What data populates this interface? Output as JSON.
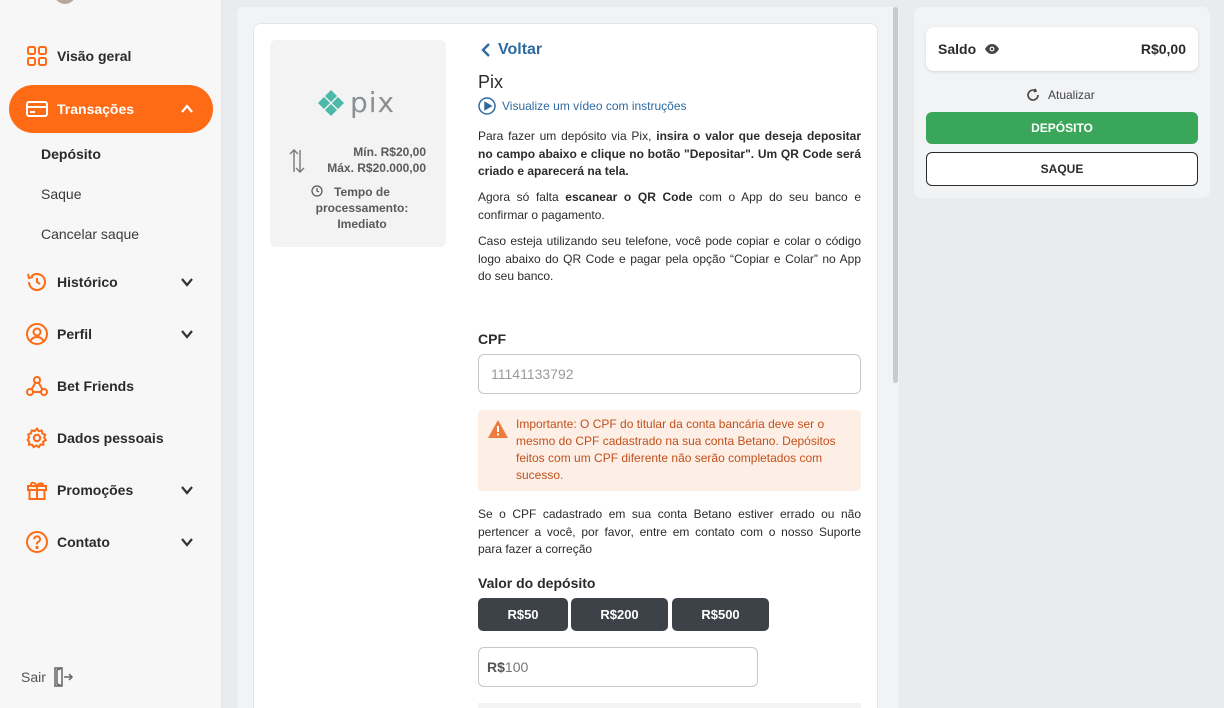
{
  "sidebar": {
    "items": [
      {
        "label": "Visão geral",
        "icon": "grid-icon"
      },
      {
        "label": "Transações",
        "icon": "card-icon"
      },
      {
        "label": "Histórico",
        "icon": "history-icon"
      },
      {
        "label": "Perfil",
        "icon": "user-icon"
      },
      {
        "label": "Bet Friends",
        "icon": "friends-icon"
      },
      {
        "label": "Dados pessoais",
        "icon": "gear-icon"
      },
      {
        "label": "Promoções",
        "icon": "gift-icon"
      },
      {
        "label": "Contato",
        "icon": "help-icon"
      }
    ],
    "subitems": [
      "Depósito",
      "Saque",
      "Cancelar saque"
    ],
    "logout": "Sair"
  },
  "method": {
    "min": "Mín. R$20,00",
    "max": "Máx. R$20.000,00",
    "processing": "Tempo de processamento: Imediato"
  },
  "main": {
    "back": "Voltar",
    "title": "Pix",
    "video_link": "Visualize um vídeo com instruções",
    "p1": {
      "a": "Para fazer um depósito via Pix, ",
      "b": "insira o valor que deseja depositar no campo abaixo e clique no botão \"Depositar\". Um QR Code será criado e aparecerá na tela."
    },
    "p2": {
      "a": "Agora só falta ",
      "b": "escanear o QR Code",
      "c": " com o App do seu banco e confirmar o pagamento."
    },
    "p3": "Caso esteja utilizando seu telefone, você pode copiar e colar o código logo abaixo do QR Code e pagar pela opção “Copiar e Colar” no App do seu banco.",
    "cpf_label": "CPF",
    "cpf_placeholder": "11141133792",
    "warning": "Importante: O CPF do titular da conta bancária deve ser o mesmo do CPF cadastrado na sua conta Betano. Depósitos feitos com um CPF diferente não serão completados com sucesso.",
    "p4": "Se o CPF cadastrado em sua conta Betano estiver errado ou não pertencer a você, por favor, entre em contato com o nosso Suporte para fazer a correção",
    "value_label": "Valor do depósito",
    "chips": [
      "R$50",
      "R$200",
      "R$500"
    ],
    "amount_currency": "R$",
    "amount_value": "100"
  },
  "balance": {
    "label": "Saldo",
    "value": "R$0,00",
    "refresh": "Atualizar",
    "deposit_btn": "DEPÓSITO",
    "withdraw_btn": "SAQUE"
  },
  "colors": {
    "accent": "#ff6a14",
    "deposit": "#3aa65a",
    "link": "#2d6aa0",
    "warning_text": "#c2511b",
    "pix_teal": "#4bb8a9"
  }
}
